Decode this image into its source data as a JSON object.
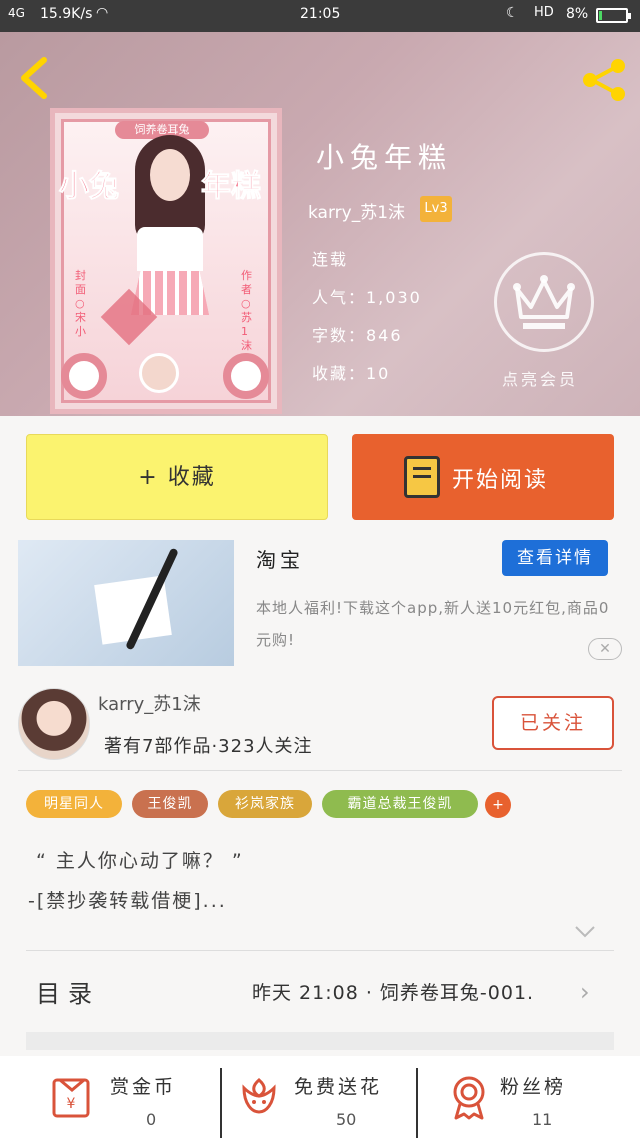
{
  "status_bar": {
    "network": "4G",
    "speed": "15.9K/s",
    "time": "21:05",
    "hd": "HD",
    "battery_pct": "8%",
    "battery_level": 0.08
  },
  "book": {
    "title": "小兔年糕",
    "author": "karry_苏1沫",
    "level": "Lv3",
    "status": "连载",
    "popularity_line": "人气：1,030",
    "wordcount_line": "字数：846",
    "collect_line": "收藏：10",
    "vip_label": "点亮会员"
  },
  "cover": {
    "banner": "饲养卷耳兔",
    "big_left": "小兔",
    "big_right": "年糕",
    "side_left": "封面○宋小",
    "side_right": "作者○苏1沫"
  },
  "actions": {
    "favorite": "+ 收藏",
    "read": "开始阅读"
  },
  "ad": {
    "title": "淘宝",
    "button": "查看详情",
    "description": "本地人福利!下载这个app,新人送10元红包,商品0元购!",
    "close": "✕"
  },
  "author_section": {
    "name": "karry_苏1沫",
    "stats": "著有7部作品·323人关注",
    "follow_button": "已关注"
  },
  "tags": [
    {
      "label": "明星同人",
      "color": "#f3b23a"
    },
    {
      "label": "王俊凯",
      "color": "#c9714f"
    },
    {
      "label": "衫岚家族",
      "color": "#d9a63a"
    },
    {
      "label": "霸道总裁王俊凯",
      "color": "#8fbb4f"
    }
  ],
  "tag_more": "+",
  "intro": {
    "line1": "“ 主人你心动了嘛？ ”",
    "line2": "-[禁抄袭转载借梗]..."
  },
  "toc": {
    "label": "目录",
    "latest": "昨天 21:08 · 饲养卷耳兔-001.",
    "arrow": "›"
  },
  "bottom_bar": [
    {
      "label": "赏金币",
      "count": "0",
      "icon": "money-envelope-icon"
    },
    {
      "label": "免费送花",
      "count": "50",
      "icon": "flower-icon"
    },
    {
      "label": "粉丝榜",
      "count": "11",
      "icon": "ribbon-badge-icon"
    }
  ],
  "colors": {
    "accent_orange": "#e8612e",
    "accent_yellow": "#fbf36f",
    "back_arrow": "#ffd400",
    "link_blue": "#1e6fd8",
    "follow_red": "#d9533a"
  }
}
